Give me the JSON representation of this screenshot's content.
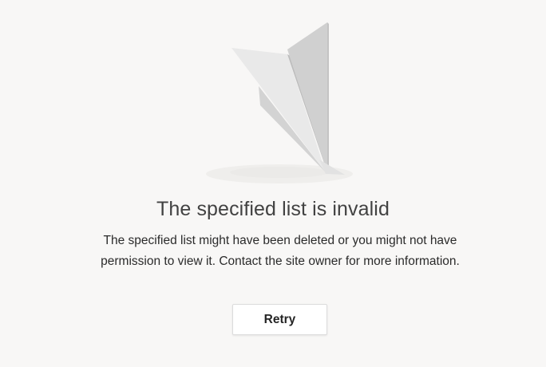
{
  "error": {
    "title": "The specified list is invalid",
    "message": "The specified list might have been deleted or you might not have permission to view it. Contact the site owner for more information.",
    "retry_label": "Retry",
    "illustration_icon": "paper-plane-icon"
  },
  "colors": {
    "background": "#f8f7f6",
    "title_text": "#424242",
    "body_text": "#2b2b2b",
    "button_bg": "#ffffff",
    "button_border": "#dcdcdc"
  }
}
